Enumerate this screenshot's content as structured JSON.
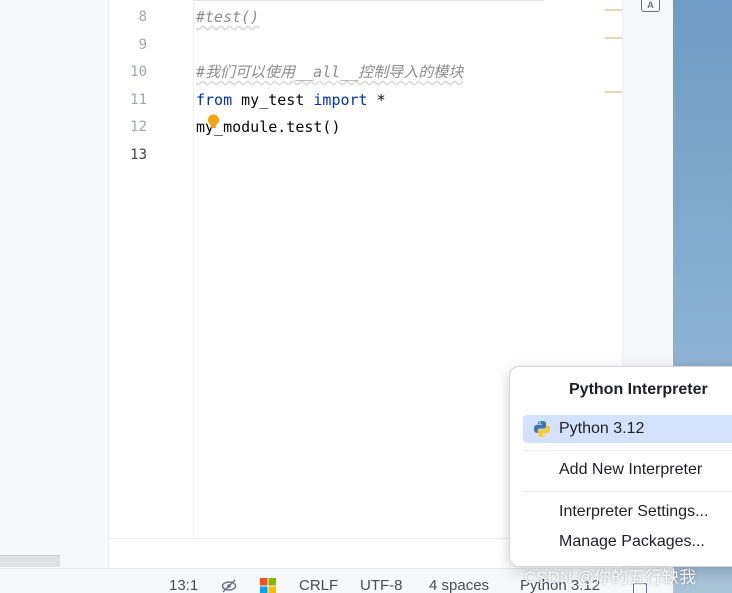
{
  "editor": {
    "lines": [
      {
        "num": "8",
        "text": "#test()"
      },
      {
        "num": "9",
        "text": ""
      },
      {
        "num": "10",
        "text": "#我们可以使用__all__控制导入的模块"
      },
      {
        "num": "11",
        "kw1": "from",
        "mid": " my_test ",
        "kw2": "import",
        "tail": " *"
      },
      {
        "num": "12",
        "text": "my_module.test()"
      },
      {
        "num": "13",
        "text": ""
      }
    ],
    "ai_badge": "A"
  },
  "status_bar": {
    "position": "13:1",
    "line_ending": "CRLF",
    "encoding": "UTF-8",
    "indent": "4 spaces",
    "interpreter": "Python 3.12"
  },
  "interpreter_popup": {
    "title": "Python Interpreter",
    "selected": "Python 3.12",
    "add_new": "Add New Interpreter",
    "settings": "Interpreter Settings...",
    "manage": "Manage Packages..."
  },
  "watermark": "CSDN @你的五行缺我",
  "colors": {
    "keyword": "#0033b3",
    "comment": "#8c8c8c",
    "selection": "#d4e2ff",
    "current_line": "#f5f8fe"
  }
}
